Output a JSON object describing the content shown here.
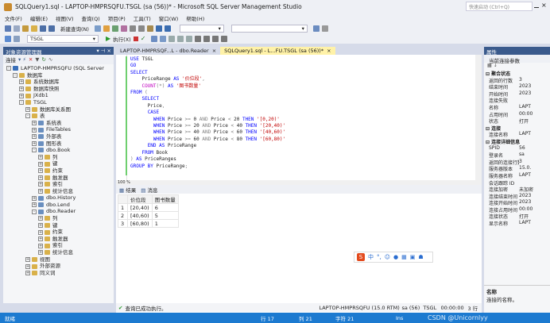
{
  "title": "SQLQuery1.sql - LAPTOP-HMPRSQFU.TSGL (sa (56))* - Microsoft SQL Server Management Studio",
  "quick_launch": "快速启动 (Ctrl+Q)",
  "menu": [
    "文件(F)",
    "编辑(E)",
    "视图(V)",
    "查询(Q)",
    "项目(P)",
    "工具(T)",
    "窗口(W)",
    "帮助(H)"
  ],
  "toolbar": {
    "new_query": "新建查询(N)",
    "database": "TSGL",
    "execute": "执行(X)"
  },
  "object_explorer": {
    "title": "对象资源管理器",
    "connect": "连接",
    "items": [
      {
        "label": "LAPTOP-HMPRSQFU (SQL Server",
        "level": 0,
        "exp": "-"
      },
      {
        "label": "数据库",
        "level": 1,
        "exp": "-"
      },
      {
        "label": "系统数据库",
        "level": 2,
        "exp": "+"
      },
      {
        "label": "数据库快照",
        "level": 2,
        "exp": "+"
      },
      {
        "label": "JXdb1",
        "level": 2,
        "exp": "+"
      },
      {
        "label": "TSGL",
        "level": 2,
        "exp": "-"
      },
      {
        "label": "数据库关系图",
        "level": 3,
        "exp": "+"
      },
      {
        "label": "表",
        "level": 3,
        "exp": "-"
      },
      {
        "label": "系统表",
        "level": 4,
        "exp": "+"
      },
      {
        "label": "FileTables",
        "level": 4,
        "exp": "+"
      },
      {
        "label": "外部表",
        "level": 4,
        "exp": "+"
      },
      {
        "label": "图形表",
        "level": 4,
        "exp": "+"
      },
      {
        "label": "dbo.Book",
        "level": 4,
        "exp": "-"
      },
      {
        "label": "列",
        "level": 5,
        "exp": "+"
      },
      {
        "label": "键",
        "level": 5,
        "exp": "+"
      },
      {
        "label": "约束",
        "level": 5,
        "exp": "+"
      },
      {
        "label": "触发器",
        "level": 5,
        "exp": "+"
      },
      {
        "label": "索引",
        "level": 5,
        "exp": "+"
      },
      {
        "label": "统计信息",
        "level": 5,
        "exp": "+"
      },
      {
        "label": "dbo.History",
        "level": 4,
        "exp": "+"
      },
      {
        "label": "dbo.Lend",
        "level": 4,
        "exp": "+"
      },
      {
        "label": "dbo.Reader",
        "level": 4,
        "exp": "-"
      },
      {
        "label": "列",
        "level": 5,
        "exp": "+"
      },
      {
        "label": "键",
        "level": 5,
        "exp": "+"
      },
      {
        "label": "约束",
        "level": 5,
        "exp": "+"
      },
      {
        "label": "触发器",
        "level": 5,
        "exp": "+"
      },
      {
        "label": "索引",
        "level": 5,
        "exp": "+"
      },
      {
        "label": "统计信息",
        "level": 5,
        "exp": "+"
      },
      {
        "label": "视图",
        "level": 3,
        "exp": "+"
      },
      {
        "label": "外部资源",
        "level": 3,
        "exp": "+"
      },
      {
        "label": "同义词",
        "level": 3,
        "exp": "+"
      }
    ]
  },
  "tabs": [
    {
      "label": "LAPTOP-HMPRSQF...L - dbo.Reader",
      "active": false
    },
    {
      "label": "SQLQuery1.sql - L...FU.TSGL (sa (56))*",
      "active": true
    }
  ],
  "code_lines": [
    [
      [
        "kw",
        "USE "
      ],
      [
        "",
        "TSGL"
      ]
    ],
    [
      [
        "kw",
        "GO"
      ]
    ],
    [
      [
        "kw",
        "SELECT"
      ]
    ],
    [
      [
        "",
        "    PriceRange "
      ],
      [
        "kw",
        "AS "
      ],
      [
        "str",
        "'价位段'"
      ],
      [
        "gr",
        ","
      ]
    ],
    [
      [
        "",
        "    "
      ],
      [
        "fn",
        "COUNT"
      ],
      [
        "gr",
        "(*) "
      ],
      [
        "kw",
        "AS "
      ],
      [
        "str",
        "'图书数量'"
      ]
    ],
    [
      [
        "kw",
        "FROM "
      ],
      [
        "gr",
        "("
      ]
    ],
    [
      [
        "",
        "    "
      ],
      [
        "kw",
        "SELECT"
      ]
    ],
    [
      [
        "",
        "      Price"
      ],
      [
        "gr",
        ","
      ]
    ],
    [
      [
        "",
        "      "
      ],
      [
        "kw",
        "CASE"
      ]
    ],
    [
      [
        "",
        "        "
      ],
      [
        "kw",
        "WHEN "
      ],
      [
        "",
        "Price "
      ],
      [
        "gr",
        ">= "
      ],
      [
        "",
        "0 "
      ],
      [
        "gr",
        "AND "
      ],
      [
        "",
        "Price "
      ],
      [
        "gr",
        "< "
      ],
      [
        "",
        "20 "
      ],
      [
        "kw",
        "THEN "
      ],
      [
        "str",
        "'[0,20)'"
      ]
    ],
    [
      [
        "",
        "        "
      ],
      [
        "kw",
        "WHEN "
      ],
      [
        "",
        "Price "
      ],
      [
        "gr",
        ">= "
      ],
      [
        "",
        "20 "
      ],
      [
        "gr",
        "AND "
      ],
      [
        "",
        "Price "
      ],
      [
        "gr",
        "< "
      ],
      [
        "",
        "40 "
      ],
      [
        "kw",
        "THEN "
      ],
      [
        "str",
        "'[20,40)'"
      ]
    ],
    [
      [
        "",
        "        "
      ],
      [
        "kw",
        "WHEN "
      ],
      [
        "",
        "Price "
      ],
      [
        "gr",
        ">= "
      ],
      [
        "",
        "40 "
      ],
      [
        "gr",
        "AND "
      ],
      [
        "",
        "Price "
      ],
      [
        "gr",
        "< "
      ],
      [
        "",
        "60 "
      ],
      [
        "kw",
        "THEN "
      ],
      [
        "str",
        "'[40,60)'"
      ]
    ],
    [
      [
        "",
        "        "
      ],
      [
        "kw",
        "WHEN "
      ],
      [
        "",
        "Price "
      ],
      [
        "gr",
        ">= "
      ],
      [
        "",
        "60 "
      ],
      [
        "gr",
        "AND "
      ],
      [
        "",
        "Price "
      ],
      [
        "gr",
        "< "
      ],
      [
        "",
        "80 "
      ],
      [
        "kw",
        "THEN "
      ],
      [
        "str",
        "'[60,80)'"
      ]
    ],
    [
      [
        "",
        "      "
      ],
      [
        "kw",
        "END AS "
      ],
      [
        "",
        "PriceRange"
      ]
    ],
    [
      [
        "",
        "    "
      ],
      [
        "kw",
        "FROM "
      ],
      [
        "",
        "Book"
      ]
    ],
    [
      [
        "gr",
        ") "
      ],
      [
        "kw",
        "AS "
      ],
      [
        "",
        "PriceRanges"
      ]
    ],
    [
      [
        "kw",
        "GROUP BY "
      ],
      [
        "",
        "PriceRange"
      ],
      [
        "gr",
        ";"
      ]
    ]
  ],
  "zoom": "100 %",
  "results": {
    "tab_results": "结果",
    "tab_messages": "消息",
    "columns": [
      "价位段",
      "图书数量"
    ],
    "rows": [
      [
        "1",
        "[20,40)",
        "6"
      ],
      [
        "2",
        "[40,60)",
        "5"
      ],
      [
        "3",
        "[60,80)",
        "1"
      ]
    ]
  },
  "query_status": {
    "message": "查询已成功执行。",
    "server": "LAPTOP-HMPRSQFU (15.0 RTM)",
    "user": "sa (56)",
    "db": "TSGL",
    "time": "00:00:00",
    "rows": "3 行"
  },
  "statusbar": {
    "ready": "就绪",
    "line": "行 17",
    "col": "列 21",
    "char": "字符 21",
    "ins": "Ins"
  },
  "properties": {
    "title": "属性",
    "subtitle": "当前连接参数",
    "groups": [
      {
        "name": "聚合状态",
        "rows": [
          [
            "返回的行数",
            "3"
          ],
          [
            "结束时间",
            "2023"
          ],
          [
            "开始时间",
            "2023"
          ],
          [
            "连接失败",
            ""
          ],
          [
            "名称",
            "LAPT"
          ],
          [
            "占用时间",
            "00:00"
          ],
          [
            "状态",
            "打开"
          ]
        ]
      },
      {
        "name": "连接",
        "rows": [
          [
            "连接名称",
            "LAPT"
          ]
        ]
      },
      {
        "name": "连接详细信息",
        "rows": [
          [
            "SPID",
            "56"
          ],
          [
            "登录名",
            "sa"
          ],
          [
            "返回的连接行数",
            "3"
          ],
          [
            "服务器版本",
            "15.0."
          ],
          [
            "服务器名称",
            "LAPT"
          ],
          [
            "会话跟踪 ID",
            ""
          ],
          [
            "连接加密",
            "未加密"
          ],
          [
            "连接结束时间",
            "2023"
          ],
          [
            "连接开始时间",
            "2023"
          ],
          [
            "连接占用时间",
            "00:00"
          ],
          [
            "连接状态",
            "打开"
          ],
          [
            "显示名称",
            "LAPT"
          ]
        ]
      }
    ],
    "footer_title": "名称",
    "footer_desc": "连接的名称。"
  },
  "ime": {
    "brand": "S",
    "label": "中"
  },
  "watermark": "CSDN @Unicornlyy"
}
